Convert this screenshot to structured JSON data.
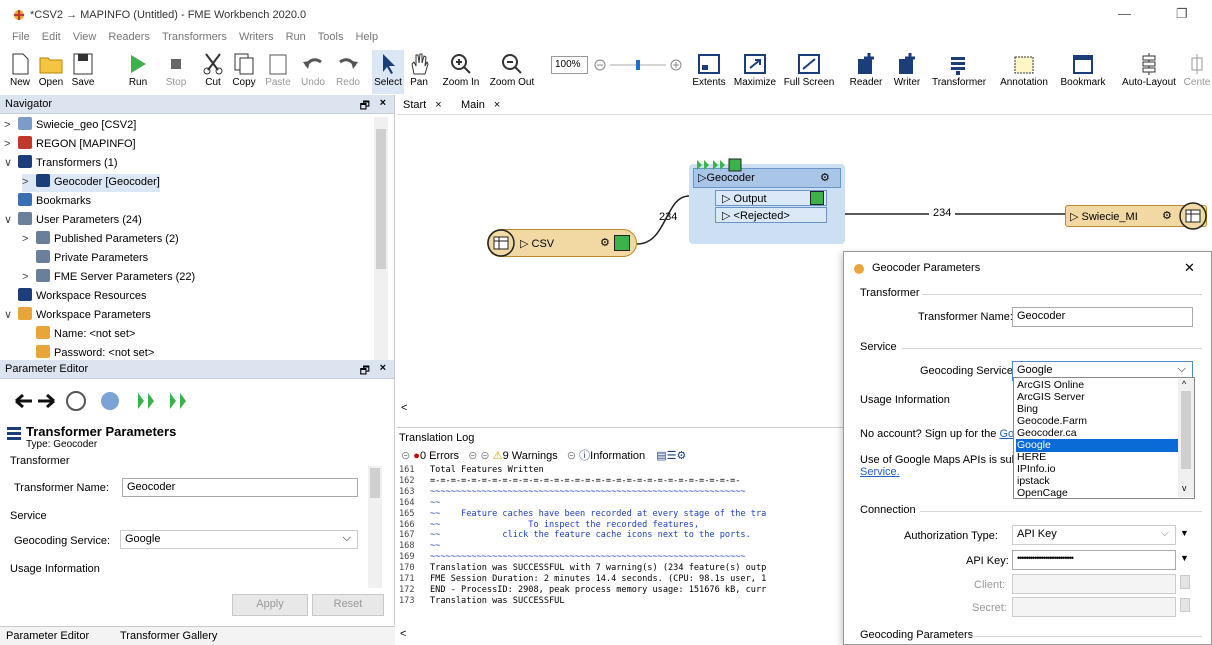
{
  "window": {
    "title": "*CSV2 → MAPINFO (Untitled) - FME Workbench 2020.0",
    "minimize": "—",
    "maximize": "❐"
  },
  "menu": [
    "File",
    "Edit",
    "View",
    "Readers",
    "Transformers",
    "Writers",
    "Run",
    "Tools",
    "Help"
  ],
  "toolbar": {
    "new": "New",
    "open": "Open",
    "save": "Save",
    "run": "Run",
    "stop": "Stop",
    "cut": "Cut",
    "copy": "Copy",
    "paste": "Paste",
    "undo": "Undo",
    "redo": "Redo",
    "select": "Select",
    "pan": "Pan",
    "zoom_in": "Zoom In",
    "zoom_out": "Zoom Out",
    "zoom_level": "100%",
    "extents": "Extents",
    "maximize": "Maximize",
    "full_screen": "Full Screen",
    "reader": "Reader",
    "writer": "Writer",
    "transformer": "Transformer",
    "annotation": "Annotation",
    "bookmark": "Bookmark",
    "auto_layout": "Auto-Layout",
    "center": "Cente"
  },
  "navigator": {
    "title": "Navigator",
    "items": [
      {
        "label": "Swiecie_geo [CSV2]",
        "arrow": ">",
        "indent": 0
      },
      {
        "label": "REGON [MAPINFO]",
        "arrow": ">",
        "indent": 0
      },
      {
        "label": "Transformers (1)",
        "arrow": "∨",
        "indent": 0
      },
      {
        "label": "Geocoder [Geocoder]",
        "arrow": ">",
        "indent": 1
      },
      {
        "label": "Bookmarks",
        "arrow": "",
        "indent": 0
      },
      {
        "label": "User Parameters (24)",
        "arrow": "∨",
        "indent": 0
      },
      {
        "label": "Published Parameters (2)",
        "arrow": ">",
        "indent": 1
      },
      {
        "label": "Private Parameters",
        "arrow": "",
        "indent": 1
      },
      {
        "label": "FME Server Parameters (22)",
        "arrow": ">",
        "indent": 1
      },
      {
        "label": "Workspace Resources",
        "arrow": "",
        "indent": 0
      },
      {
        "label": "Workspace Parameters",
        "arrow": "∨",
        "indent": 0
      },
      {
        "label": "Name: <not set>",
        "arrow": "",
        "indent": 1
      },
      {
        "label": "Password: <not set>",
        "arrow": "",
        "indent": 1
      }
    ]
  },
  "param_editor": {
    "title": "Parameter Editor",
    "heading": "Transformer Parameters",
    "type": "Type: Geocoder",
    "group_transformer": "Transformer",
    "transformer_name_label": "Transformer Name:",
    "transformer_name_value": "Geocoder",
    "group_service": "Service",
    "geocoding_service_label": "Geocoding Service:",
    "geocoding_service_value": "Google",
    "group_usage": "Usage Information",
    "apply": "Apply",
    "reset": "Reset"
  },
  "bottom_tabs": [
    "Parameter Editor",
    "Transformer Gallery"
  ],
  "canvas": {
    "tabs": [
      "Start",
      "Main"
    ],
    "close": "×",
    "csv_node": "CSV",
    "geocoder_node": "Geocoder",
    "port_output": "Output",
    "port_rejected": "<Rejected>",
    "writer_node": "Swiecie_MI",
    "count_left": "234",
    "count_right": "234"
  },
  "log": {
    "title": "Translation Log",
    "errors": "0 Errors",
    "warnings": "9 Warnings",
    "information": "Information",
    "lines": [
      {
        "n": "161",
        "t": "Total Features Written"
      },
      {
        "n": "162",
        "t": "=-=-=-=-=-=-=-=-=-=-=-=-=-=-=-=-=-=-=-=-=-=-=-=-=-=-=-=-=-=-"
      },
      {
        "n": "163",
        "t": "~~~~~~~~~~~~~~~~~~~~~~~~~~~~~~~~~~~~~~~~~~~~~~~~~~~~~~~~~~~~~"
      },
      {
        "n": "164",
        "t": "~~"
      },
      {
        "n": "165",
        "t": "~~    Feature caches have been recorded at every stage of the tra"
      },
      {
        "n": "166",
        "t": "~~                 To inspect the recorded features,"
      },
      {
        "n": "167",
        "t": "~~            click the feature cache icons next to the ports."
      },
      {
        "n": "168",
        "t": "~~"
      },
      {
        "n": "169",
        "t": "~~~~~~~~~~~~~~~~~~~~~~~~~~~~~~~~~~~~~~~~~~~~~~~~~~~~~~~~~~~~~"
      },
      {
        "n": "170",
        "t": "Translation was SUCCESSFUL with 7 warning(s) (234 feature(s) outp"
      },
      {
        "n": "171",
        "t": "FME Session Duration: 2 minutes 14.4 seconds. (CPU: 98.1s user, 1"
      },
      {
        "n": "172",
        "t": "END - ProcessID: 2908, peak process memory usage: 151676 kB, curr"
      },
      {
        "n": "173",
        "t": "Translation was SUCCESSFUL"
      }
    ]
  },
  "dialog": {
    "title": "Geocoder Parameters",
    "close": "✕",
    "group_transformer": "Transformer",
    "transformer_name_label": "Transformer Name:",
    "transformer_name_value": "Geocoder",
    "group_service": "Service",
    "geocoding_service_label": "Geocoding Service:",
    "geocoding_service_value": "Google",
    "group_usage": "Usage Information",
    "usage_text_1": "No account? Sign up for the ",
    "usage_link_1": "Goog",
    "usage_text_2": "Use of Google Maps APIs is subje",
    "usage_link_2": "Service.",
    "group_connection": "Connection",
    "auth_type_label": "Authorization Type:",
    "auth_type_value": "API Key",
    "api_key_label": "API Key:",
    "api_key_value": "••••••••••••••••••••••••••",
    "client_label": "Client:",
    "secret_label": "Secret:",
    "group_geocoding": "Geocoding Parameters"
  },
  "service_options": {
    "items": [
      "ArcGIS Online",
      "ArcGIS Server",
      "Bing",
      "Geocode.Farm",
      "Geocoder.ca",
      "Google",
      "HERE",
      "IPInfo.io",
      "ipstack",
      "OpenCage"
    ],
    "selected": "Google"
  }
}
